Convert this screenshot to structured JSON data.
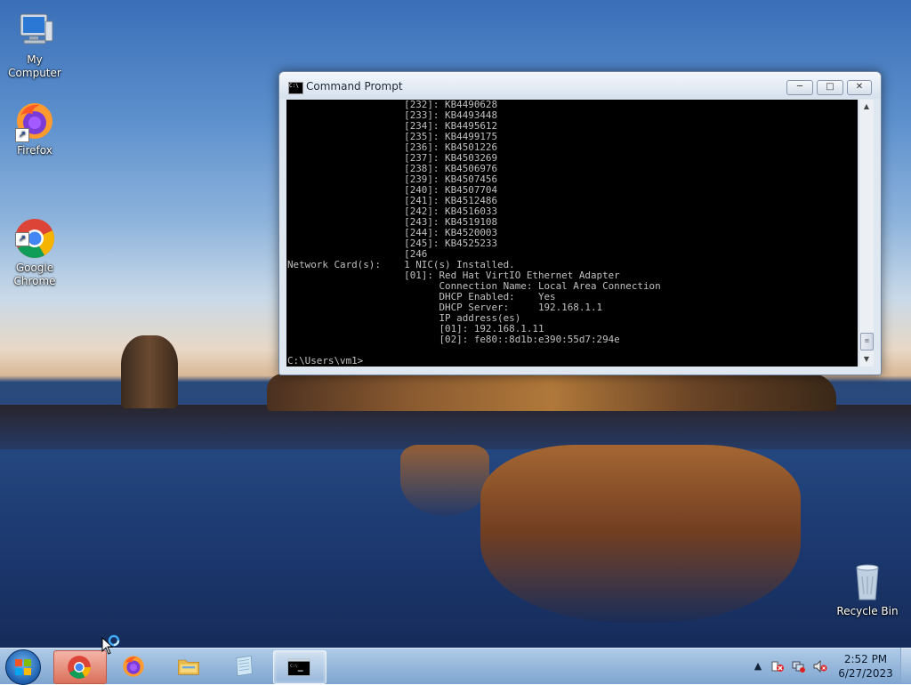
{
  "desktop": {
    "icons": [
      {
        "label": "My Computer",
        "icon": "computer-icon"
      },
      {
        "label": "Firefox",
        "icon": "firefox-icon"
      },
      {
        "label": "Google\nChrome",
        "icon": "chrome-icon"
      },
      {
        "label": "Recycle Bin",
        "icon": "recycle-bin-icon"
      }
    ]
  },
  "window": {
    "title": "Command Prompt",
    "controls": {
      "minimize": "─",
      "maximize": "□",
      "close": "✕"
    },
    "console_lines": [
      "                    [232]: KB4490628",
      "                    [233]: KB4493448",
      "                    [234]: KB4495612",
      "                    [235]: KB4499175",
      "                    [236]: KB4501226",
      "                    [237]: KB4503269",
      "                    [238]: KB4506976",
      "                    [239]: KB4507456",
      "                    [240]: KB4507704",
      "                    [241]: KB4512486",
      "                    [242]: KB4516033",
      "                    [243]: KB4519108",
      "                    [244]: KB4520003",
      "                    [245]: KB4525233",
      "                    [246",
      "Network Card(s):    1 NIC(s) Installed.",
      "                    [01]: Red Hat VirtIO Ethernet Adapter",
      "                          Connection Name: Local Area Connection",
      "                          DHCP Enabled:    Yes",
      "                          DHCP Server:     192.168.1.1",
      "                          IP address(es)",
      "                          [01]: 192.168.1.11",
      "                          [02]: fe80::8d1b:e390:55d7:294e",
      "",
      "C:\\Users\\vm1>"
    ]
  },
  "taskbar": {
    "items": [
      {
        "name": "Google Chrome",
        "icon": "chrome-icon"
      },
      {
        "name": "Firefox",
        "icon": "firefox-icon"
      },
      {
        "name": "Windows Explorer",
        "icon": "folder-icon"
      },
      {
        "name": "Notepad",
        "icon": "notepad-icon"
      },
      {
        "name": "Command Prompt",
        "icon": "cmd-icon"
      }
    ],
    "clock": {
      "time": "2:52 PM",
      "date": "6/27/2023"
    }
  }
}
